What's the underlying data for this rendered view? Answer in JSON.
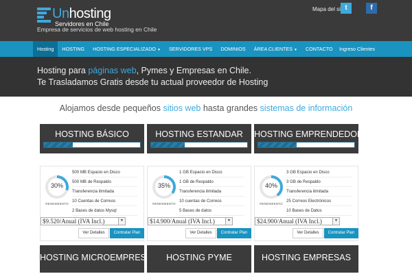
{
  "brand": {
    "name_prefix": "Un",
    "name_rest": "hosting",
    "sub": "Servidores en Chile",
    "tagline": "Empresa de servicios de web hosting en Chile"
  },
  "header": {
    "sitemap": "Mapa del sitio",
    "twitter_glyph": "t",
    "facebook_glyph": "f"
  },
  "nav": {
    "items": [
      "Hosting",
      "HOSTING",
      "HOSTING ESPECIALIZADO",
      "SERVIDORES VPS",
      "DOMINIOS",
      "ÁREA CLIENTES",
      "CONTACTO"
    ],
    "right": "Ingreso Clientes"
  },
  "hero": {
    "l1_a": "Hosting para ",
    "l1_b": "páginas web",
    "l1_c": ", Pymes y Empresas en Chile.",
    "l2": "Te Trasladamos Gratis desde tu actual proveedor de Hosting"
  },
  "subhead": {
    "a": "Alojamos desde pequeños ",
    "b": "sitios web",
    "c": " hasta grandes ",
    "d": "sistemas de información"
  },
  "plans": [
    {
      "title": "HOSTING BÁSICO",
      "bar": 0.3,
      "percent": "30%",
      "gauge_label": "RENDIMIENTO",
      "features": [
        "500 MB Espacio en Disco",
        "500 MB de Respaldo",
        "Transferencia ilimitada",
        "10 Cuentas de Correos",
        "2 Bases de datos Mysql"
      ],
      "price": "$9.520/Anual (IVA Incl.)",
      "details": "Ver Detalles",
      "contract": "Contratar Plan"
    },
    {
      "title": "HOSTING ESTANDAR",
      "bar": 0.35,
      "percent": "35%",
      "gauge_label": "RENDIMIENTO",
      "features": [
        "1 GB Espacio en Disco",
        "1 GB de Respaldo",
        "Transferencia ilimitada",
        "10 cuentas de Correos",
        "5 Bases de datos"
      ],
      "price": "$14.900/Anual (IVA Incl.)",
      "details": "Ver Detalles",
      "contract": "Contratar Plan"
    },
    {
      "title": "HOSTING EMPRENDEDOR",
      "bar": 0.4,
      "percent": "40%",
      "gauge_label": "RENDIMIENTO",
      "features": [
        "3 GB Espacio en Disco",
        "3 GB de Respaldo",
        "Transferencia ilimitada",
        "25 Correos Electrónicos",
        "10 Bases de Datos"
      ],
      "price": "$24.900/Anual (IVA Incl.)",
      "details": "Ver Detalles",
      "contract": "Contratar Plan"
    }
  ],
  "plans2": [
    {
      "title": "HOSTING MICROEMPRESA"
    },
    {
      "title": "HOSTING PYME"
    },
    {
      "title": "HOSTING EMPRESAS"
    }
  ],
  "colors": {
    "accent": "#1a93c0",
    "dark": "#3b3b3b",
    "highlight": "#3fa9dc"
  }
}
